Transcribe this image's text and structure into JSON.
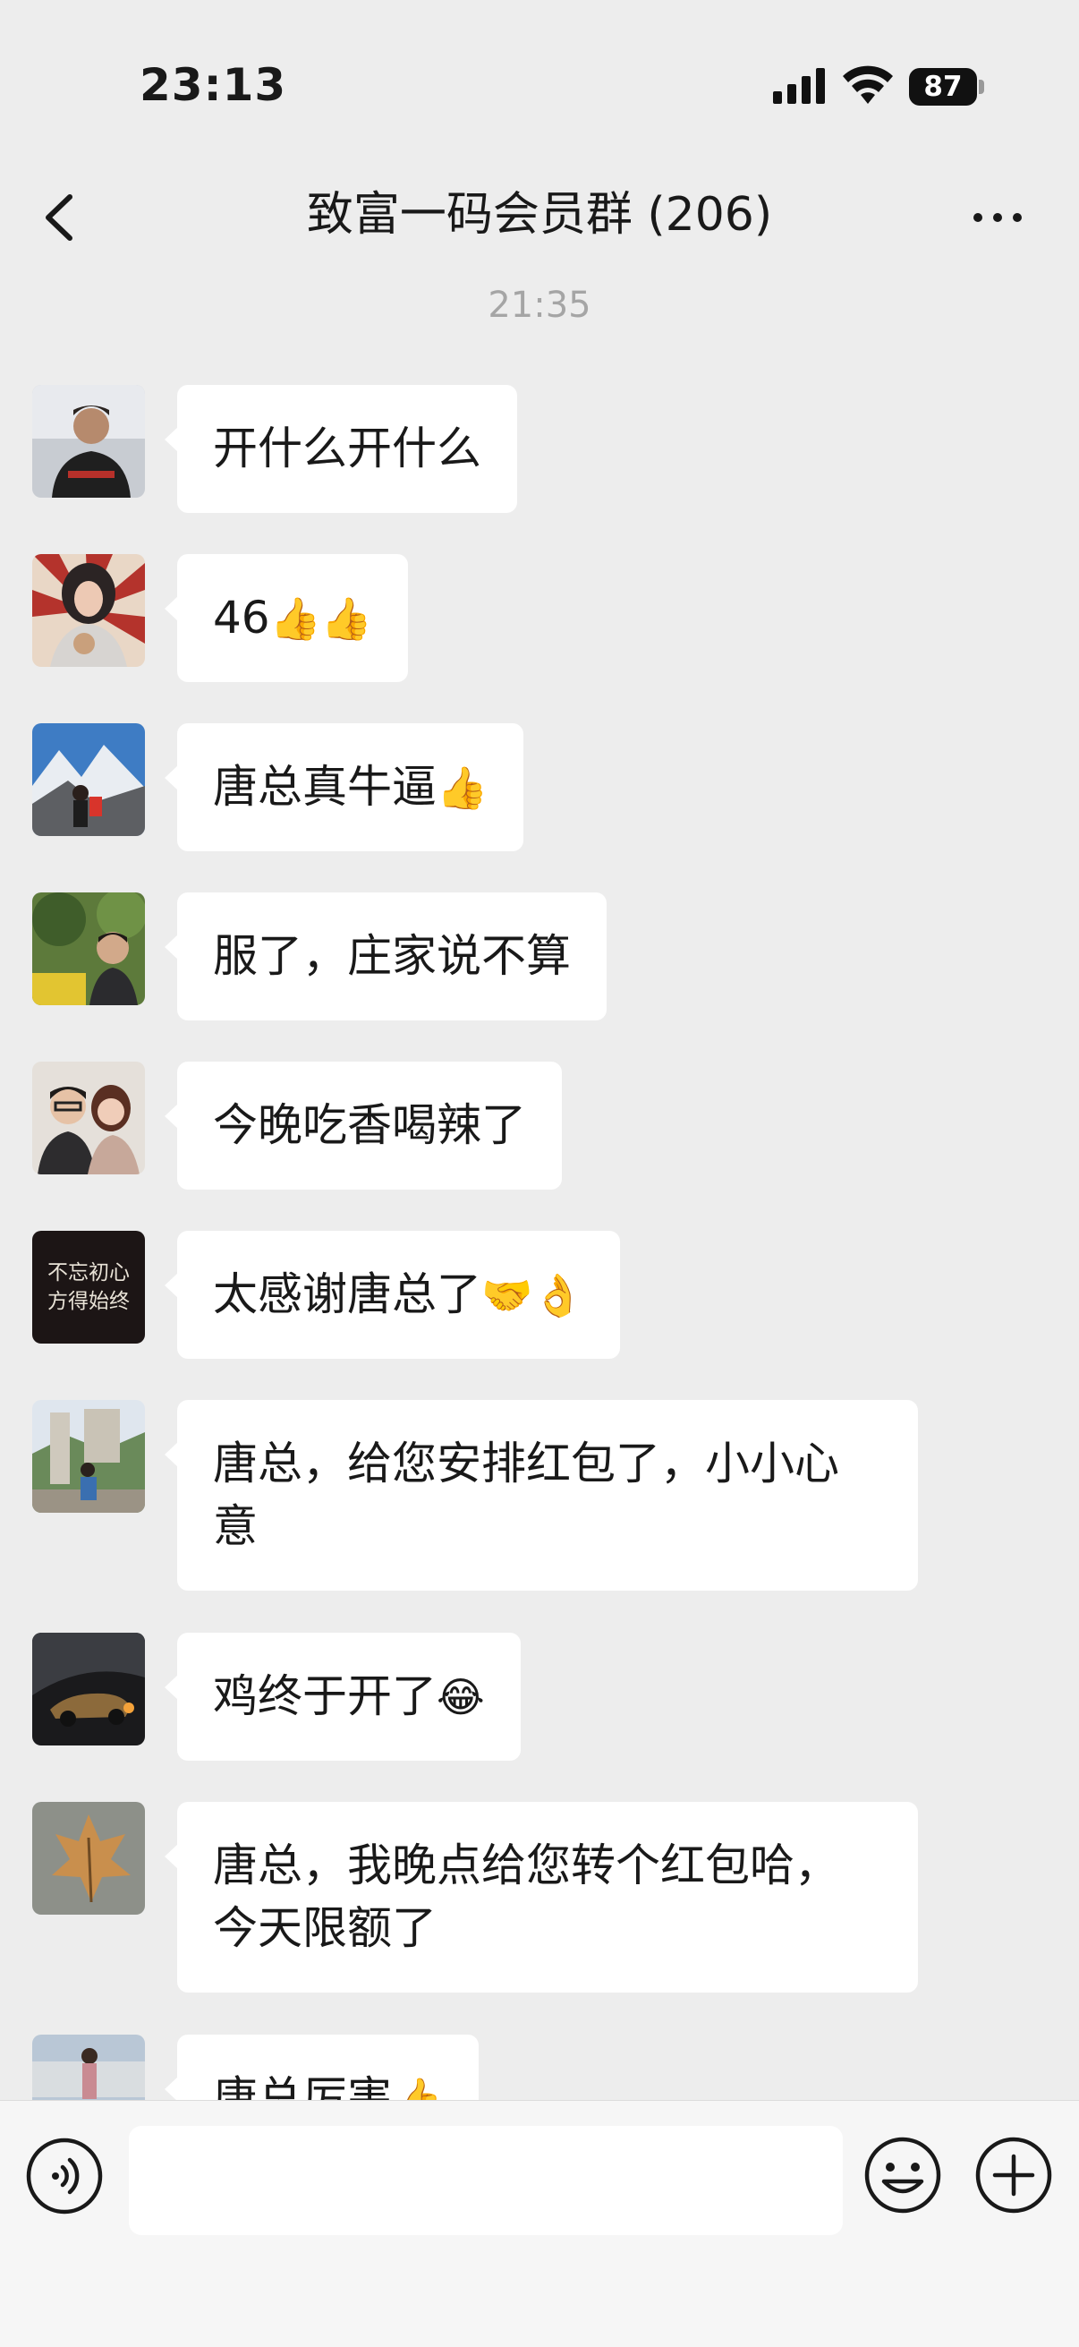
{
  "status_bar": {
    "time": "23:13",
    "battery": "87"
  },
  "header": {
    "title": "致富一码会员群 (206)"
  },
  "chat": {
    "timestamp": "21:35",
    "messages": [
      {
        "text": "开什么开什么",
        "emoji": ""
      },
      {
        "text": "46",
        "emoji": "👍👍"
      },
      {
        "text": "唐总真牛逼",
        "emoji": "👍"
      },
      {
        "text": "服了，庄家说不算",
        "emoji": ""
      },
      {
        "text": "今晚吃香喝辣了",
        "emoji": ""
      },
      {
        "text": "太感谢唐总了",
        "emoji": "🤝👌"
      },
      {
        "text": "唐总，给您安排红包了，小小心意",
        "emoji": ""
      },
      {
        "text": "鸡终于开了",
        "emoji": "😂"
      },
      {
        "text": "唐总，我晚点给您转个红包哈，今天限额了",
        "emoji": ""
      },
      {
        "text": "唐总厉害",
        "emoji": "👍"
      }
    ],
    "avatar_text": "不忘初心方得始终"
  },
  "input_bar": {
    "placeholder": ""
  },
  "colors": {
    "background": "#ededed",
    "bubble": "#ffffff",
    "timestamp": "#a5a5a5"
  }
}
